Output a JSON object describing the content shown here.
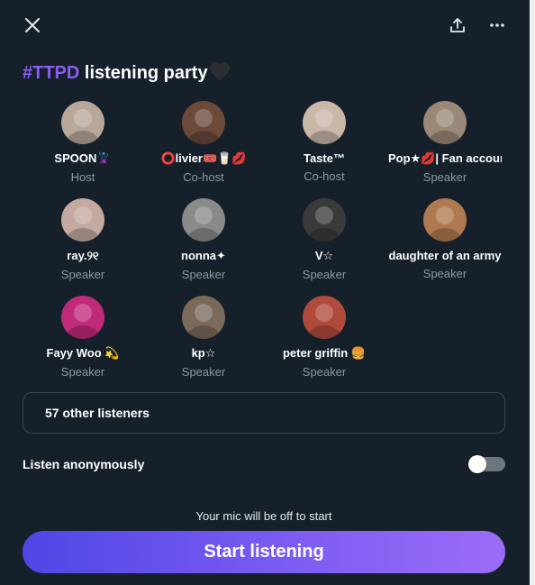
{
  "header": {
    "close_icon": "close-icon",
    "share_icon": "share-icon",
    "more_icon": "more-horizontal-icon"
  },
  "title": {
    "hashtag": "#TTPD",
    "text": " listening party",
    "heart_icon": "black-heart-icon"
  },
  "participants": [
    {
      "name": "SPOON🦹",
      "role": "Host",
      "avatar_color": "#b8a89a"
    },
    {
      "name": "⭕livier🎟️🥛💋",
      "role": "Co-host",
      "avatar_color": "#6b4a3a"
    },
    {
      "name": "Taste™",
      "role": "Co-host",
      "avatar_color": "#c9b7a8"
    },
    {
      "name": "Pop★💋| Fan account",
      "role": "Speaker",
      "avatar_color": "#9a8878"
    },
    {
      "name": "ray.୨୧",
      "role": "Speaker",
      "avatar_color": "#c4a9a0"
    },
    {
      "name": "nonna✦",
      "role": "Speaker",
      "avatar_color": "#8a8a8a"
    },
    {
      "name": "V☆",
      "role": "Speaker",
      "avatar_color": "#3a3a3a"
    },
    {
      "name": "daughter of an army",
      "role": "Speaker",
      "avatar_color": "#b07a50"
    },
    {
      "name": "Fayy Woo 💫",
      "role": "Speaker",
      "avatar_color": "#c02a7a"
    },
    {
      "name": "kp☆",
      "role": "Speaker",
      "avatar_color": "#7a6a5a"
    },
    {
      "name": "peter griffin 🍔",
      "role": "Speaker",
      "avatar_color": "#b04a3a"
    }
  ],
  "listeners": {
    "label": "57 other listeners"
  },
  "anonymous": {
    "label": "Listen anonymously",
    "enabled": false
  },
  "mic_note": "Your mic will be off to start",
  "start_button": {
    "label": "Start listening"
  },
  "colors": {
    "background": "#15202b",
    "accent": "#8b5cf6",
    "muted_text": "#8b98a5",
    "border": "#38444d"
  }
}
